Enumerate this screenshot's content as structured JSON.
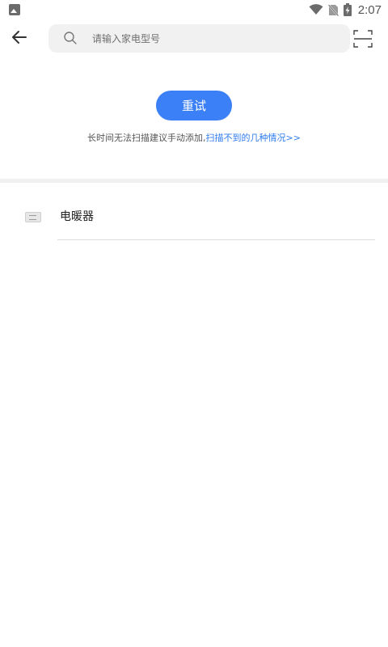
{
  "status_bar": {
    "time": "2:07",
    "icons": [
      "image-notification-icon",
      "wifi-icon",
      "no-sim-icon",
      "battery-charging-icon"
    ]
  },
  "top_bar": {
    "back_icon": "arrow-left-icon",
    "search": {
      "placeholder": "请输入家电型号",
      "value": ""
    },
    "scan_icon": "scan-frame-icon"
  },
  "retry": {
    "button_label": "重试",
    "hint_text": "长时间无法扫描建议手动添加,",
    "hint_link": "扫描不到的几种情况>>"
  },
  "devices": [
    {
      "name": "电暖器",
      "icon": "heater-thumbnail-icon"
    }
  ],
  "colors": {
    "accent": "#3b80f7",
    "link": "#2f7cf0",
    "search_bg": "#f1f1f1",
    "divider": "#f0f0f0"
  }
}
